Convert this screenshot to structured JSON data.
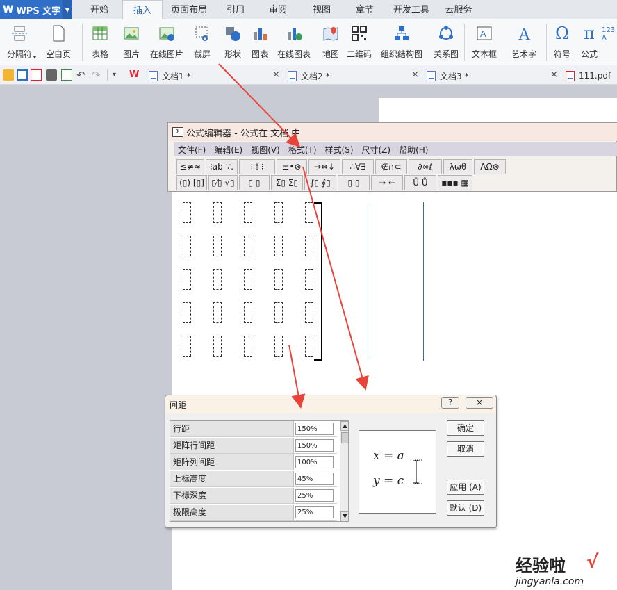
{
  "app": {
    "logo": "WPS 文字"
  },
  "tabs": [
    "开始",
    "插入",
    "页面布局",
    "引用",
    "审阅",
    "视图",
    "章节",
    "开发工具",
    "云服务"
  ],
  "ribbon": {
    "break": "分隔符",
    "blank_page": "空白页",
    "table": "表格",
    "picture": "图片",
    "online_picture": "在线图片",
    "screenshot": "截屏",
    "shape": "形状",
    "chart": "图表",
    "online_chart": "在线图表",
    "map": "地图",
    "qrcode": "二维码",
    "org_chart": "组织结构图",
    "relation": "关系图",
    "textbox": "文本框",
    "wordart": "艺术字",
    "symbol": "符号",
    "formula": "公式"
  },
  "doctabs": [
    "文档1 *",
    "文档2 *",
    "文档3 *",
    "111.pdf"
  ],
  "equation_editor": {
    "title": "公式编辑器 - 公式在 文档 中",
    "menu": [
      "文件(F)",
      "编辑(E)",
      "视图(V)",
      "格式(T)",
      "样式(S)",
      "尺寸(Z)",
      "帮助(H)"
    ],
    "toolbar_row1": [
      "≤≠≈",
      "⁝ab ∵.",
      "⁝ ⁞ ⁝",
      "±•⊗",
      "→⇔↓",
      "∴∀∃",
      "∉∩⊂",
      "∂∞ℓ",
      "λωθ",
      "ΛΩ⊗"
    ],
    "toolbar_row2": [
      "(▯) [▯]",
      "▯⁄▯ √▯",
      "▯ ▯",
      "Σ▯ Σ▯",
      "∫▯ ∮▯",
      "▯ ▯",
      "→ ←",
      "Ū Ů",
      "▪▪▪ ▦"
    ]
  },
  "spacing_dialog": {
    "title": "间距",
    "help": "?",
    "close": "×",
    "rows": [
      {
        "label": "行距",
        "value": "150%"
      },
      {
        "label": "矩阵行间距",
        "value": "150%"
      },
      {
        "label": "矩阵列间距",
        "value": "100%"
      },
      {
        "label": "上标高度",
        "value": "45%"
      },
      {
        "label": "下标深度",
        "value": "25%"
      },
      {
        "label": "极限高度",
        "value": "25%"
      }
    ],
    "preview": {
      "line1": "x = a",
      "line2": "y = c"
    },
    "buttons": {
      "ok": "确定",
      "cancel": "取消",
      "apply": "应用 (A)",
      "default": "默认 (D)"
    }
  },
  "watermark": {
    "title": "经验啦",
    "url": "jingyanla.com"
  },
  "colors": {
    "accent": "#2f6fc8",
    "arrow": "#e8443a"
  }
}
